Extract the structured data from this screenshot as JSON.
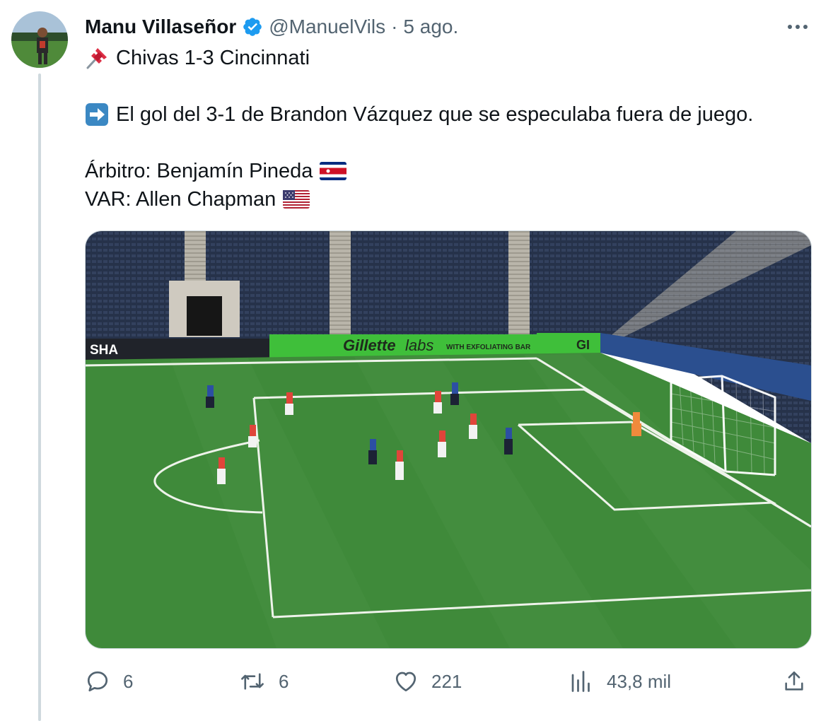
{
  "tweet": {
    "author": {
      "display_name": "Manu Villaseñor",
      "handle": "@ManuelVils",
      "verified": true,
      "avatar_icon": "avatar-photo"
    },
    "separator": "·",
    "time": "5 ago.",
    "more_icon": "more-icon",
    "lines": {
      "line1": "Chivas 1-3 Cincinnati",
      "line1_icon": "pushpin-icon",
      "line2": "El gol del 3-1 de Brandon Vázquez que se especulaba fuera de juego.",
      "line2_icon": "right-arrow-icon",
      "line3": "Árbitro: Benjamín Pineda",
      "line3_flag": "costa-rica-flag-icon",
      "line4": "VAR: Allen Chapman",
      "line4_flag": "usa-flag-icon"
    },
    "media": {
      "board_text_1": "SHA",
      "board_text_2": "Gillette",
      "board_text_3": "labs",
      "board_text_4": "WITH EXFOLIATING BAR",
      "board_text_5": "GI"
    },
    "actions": {
      "replies": "6",
      "reposts": "6",
      "likes": "221",
      "views": "43,8 mil"
    }
  },
  "colors": {
    "text": "#0f1419",
    "secondary": "#536471",
    "verified": "#1d9bf0",
    "border": "#cfd9de",
    "pitch": "#3f8a3a"
  }
}
